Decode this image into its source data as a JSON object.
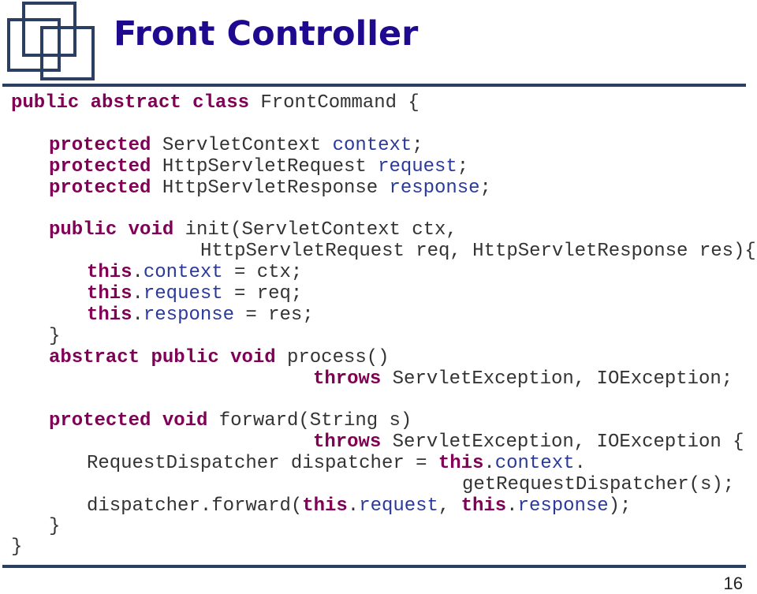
{
  "slide": {
    "title": "Front Controller",
    "page_number": "16",
    "colors": {
      "title": "#1f0a8f",
      "rule": "#2b3f63",
      "keyword": "#7f0055",
      "field": "#2a3a9c",
      "text": "#333333"
    },
    "logo_icon": "overlapping-squares-logo"
  },
  "code": {
    "language": "java",
    "lines": [
      [
        {
          "t": "kw",
          "v": "public abstract class"
        },
        {
          "t": "txt",
          "v": " FrontCommand {"
        }
      ],
      [
        {
          "t": "kw",
          "v": "protected"
        },
        {
          "t": "txt",
          "v": " ServletContext "
        },
        {
          "t": "fld",
          "v": "context"
        },
        {
          "t": "txt",
          "v": ";"
        }
      ],
      [
        {
          "t": "kw",
          "v": "protected"
        },
        {
          "t": "txt",
          "v": " HttpServletRequest "
        },
        {
          "t": "fld",
          "v": "request"
        },
        {
          "t": "txt",
          "v": ";"
        }
      ],
      [
        {
          "t": "kw",
          "v": "protected"
        },
        {
          "t": "txt",
          "v": " HttpServletResponse "
        },
        {
          "t": "fld",
          "v": "response"
        },
        {
          "t": "txt",
          "v": ";"
        }
      ],
      [
        {
          "t": "kw",
          "v": "public void"
        },
        {
          "t": "txt",
          "v": " init(ServletContext ctx,"
        }
      ],
      [
        {
          "t": "txt",
          "v": "HttpServletRequest req, HttpServletResponse res){"
        }
      ],
      [
        {
          "t": "kw",
          "v": "this"
        },
        {
          "t": "txt",
          "v": "."
        },
        {
          "t": "fld",
          "v": "context"
        },
        {
          "t": "txt",
          "v": " = ctx;"
        }
      ],
      [
        {
          "t": "kw",
          "v": "this"
        },
        {
          "t": "txt",
          "v": "."
        },
        {
          "t": "fld",
          "v": "request"
        },
        {
          "t": "txt",
          "v": " = req;"
        }
      ],
      [
        {
          "t": "kw",
          "v": "this"
        },
        {
          "t": "txt",
          "v": "."
        },
        {
          "t": "fld",
          "v": "response"
        },
        {
          "t": "txt",
          "v": " = res;"
        }
      ],
      [
        {
          "t": "txt",
          "v": "}"
        }
      ],
      [
        {
          "t": "kw",
          "v": "abstract public void"
        },
        {
          "t": "txt",
          "v": " process()"
        }
      ],
      [
        {
          "t": "kw",
          "v": "throws"
        },
        {
          "t": "txt",
          "v": " ServletException, IOException;"
        }
      ],
      [
        {
          "t": "kw",
          "v": "protected void"
        },
        {
          "t": "txt",
          "v": " forward(String s)"
        }
      ],
      [
        {
          "t": "kw",
          "v": "throws"
        },
        {
          "t": "txt",
          "v": " ServletException, IOException {"
        }
      ],
      [
        {
          "t": "txt",
          "v": "RequestDispatcher dispatcher = "
        },
        {
          "t": "kw",
          "v": "this"
        },
        {
          "t": "txt",
          "v": "."
        },
        {
          "t": "fld",
          "v": "context"
        },
        {
          "t": "txt",
          "v": "."
        }
      ],
      [
        {
          "t": "txt",
          "v": "getRequestDispatcher(s);"
        }
      ],
      [
        {
          "t": "txt",
          "v": "dispatcher.forward("
        },
        {
          "t": "kw",
          "v": "this"
        },
        {
          "t": "txt",
          "v": "."
        },
        {
          "t": "fld",
          "v": "request"
        },
        {
          "t": "txt",
          "v": ", "
        },
        {
          "t": "kw",
          "v": "this"
        },
        {
          "t": "txt",
          "v": "."
        },
        {
          "t": "fld",
          "v": "response"
        },
        {
          "t": "txt",
          "v": ");"
        }
      ],
      [
        {
          "t": "txt",
          "v": "}"
        }
      ],
      [
        {
          "t": "txt",
          "v": "}"
        }
      ]
    ]
  }
}
